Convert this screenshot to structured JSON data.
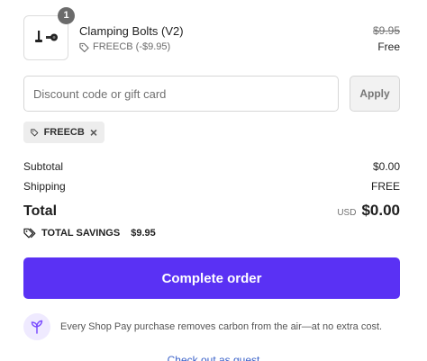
{
  "product": {
    "name": "Clamping Bolts (V2)",
    "quantity": "1",
    "discount_code": "FREECB (-$9.95)",
    "original_price": "$9.95",
    "price": "Free"
  },
  "discount": {
    "placeholder": "Discount code or gift card",
    "value": "",
    "apply_label": "Apply",
    "applied_code": "FREECB",
    "remove_glyph": "×"
  },
  "summary": {
    "subtotal_label": "Subtotal",
    "subtotal_value": "$0.00",
    "shipping_label": "Shipping",
    "shipping_value": "FREE",
    "total_label": "Total",
    "currency": "USD",
    "total_value": "$0.00",
    "savings_label": "TOTAL SAVINGS",
    "savings_value": "$9.95"
  },
  "actions": {
    "complete_order_label": "Complete order",
    "checkout_guest_label": "Check out as guest"
  },
  "carbon_note": "Every Shop Pay purchase removes carbon from the air—at no extra cost.",
  "colors": {
    "primary": "#5a31f4",
    "badge": "#6b6b6b",
    "chip_bg": "#ededed",
    "carbon_icon_bg": "#efeaff"
  },
  "icons": {
    "product_thumb": "bolts-image",
    "discount_tag": "tag-icon",
    "chip_tag": "tag-icon",
    "chip_remove": "close-icon",
    "savings": "double-tag-icon",
    "carbon": "sprout-icon"
  }
}
